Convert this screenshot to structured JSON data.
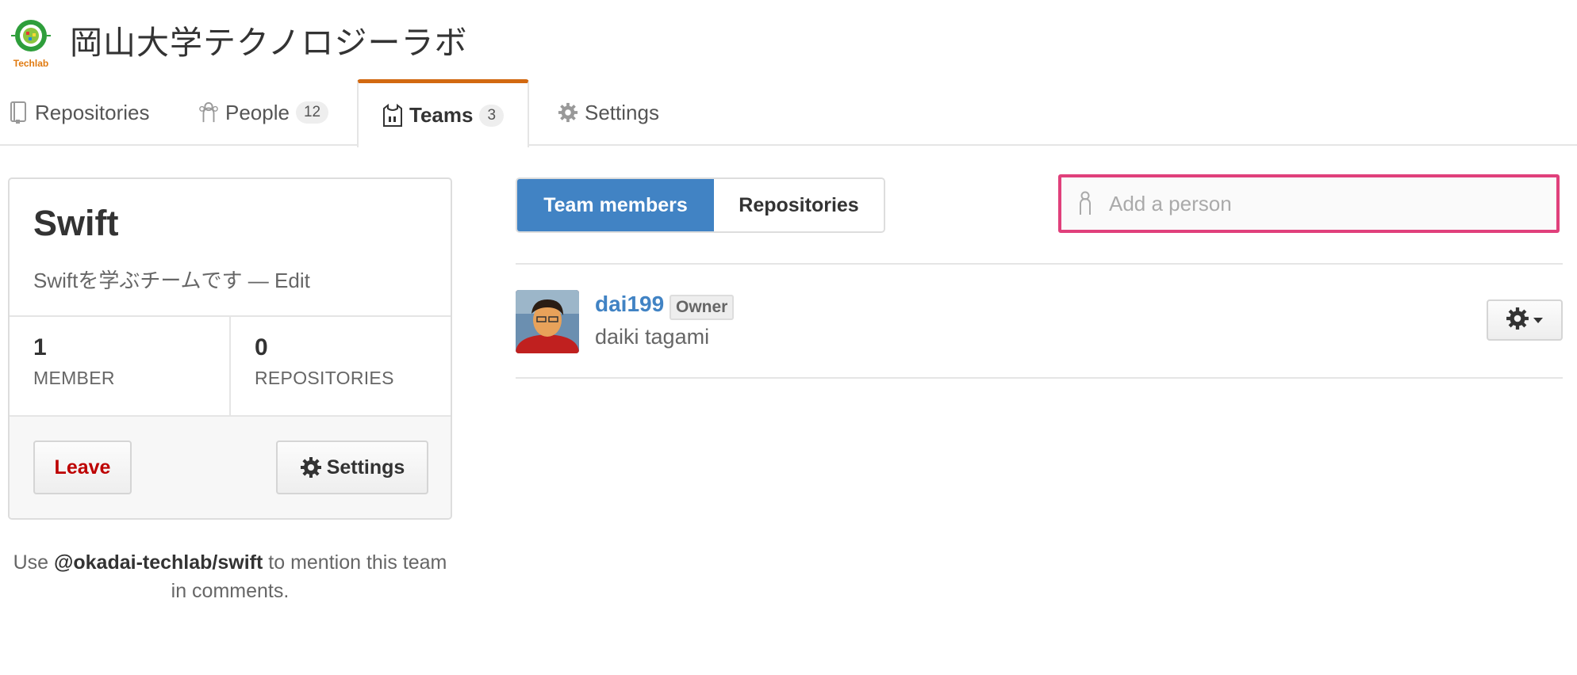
{
  "org": {
    "name": "岡山大学テクノロジーラボ",
    "logo_text": "Techlab"
  },
  "tabs": [
    {
      "label": "Repositories",
      "icon": "repo-icon"
    },
    {
      "label": "People",
      "count": "12",
      "icon": "people-icon"
    },
    {
      "label": "Teams",
      "count": "3",
      "icon": "jersey-icon",
      "selected": true
    },
    {
      "label": "Settings",
      "icon": "gear-icon"
    }
  ],
  "team": {
    "name": "Swift",
    "description": "Swiftを学ぶチームです",
    "edit_label": "Edit",
    "separator": " — ",
    "member_count": "1",
    "member_label": "MEMBER",
    "repo_count": "0",
    "repo_label": "REPOSITORIES",
    "leave_label": "Leave",
    "settings_label": "Settings"
  },
  "mention": {
    "prefix": "Use ",
    "handle": "@okadai-techlab/swift",
    "suffix": " to mention this team in comments."
  },
  "segments": {
    "members_label": "Team members",
    "repos_label": "Repositories"
  },
  "add_person": {
    "placeholder": "Add a person"
  },
  "members": [
    {
      "login": "dai199",
      "badge": "Owner",
      "name": "daiki tagami"
    }
  ],
  "colors": {
    "accent": "#4183c4",
    "tab_highlight": "#d26911",
    "danger": "#bd0000",
    "focus_border": "#e0407b"
  }
}
